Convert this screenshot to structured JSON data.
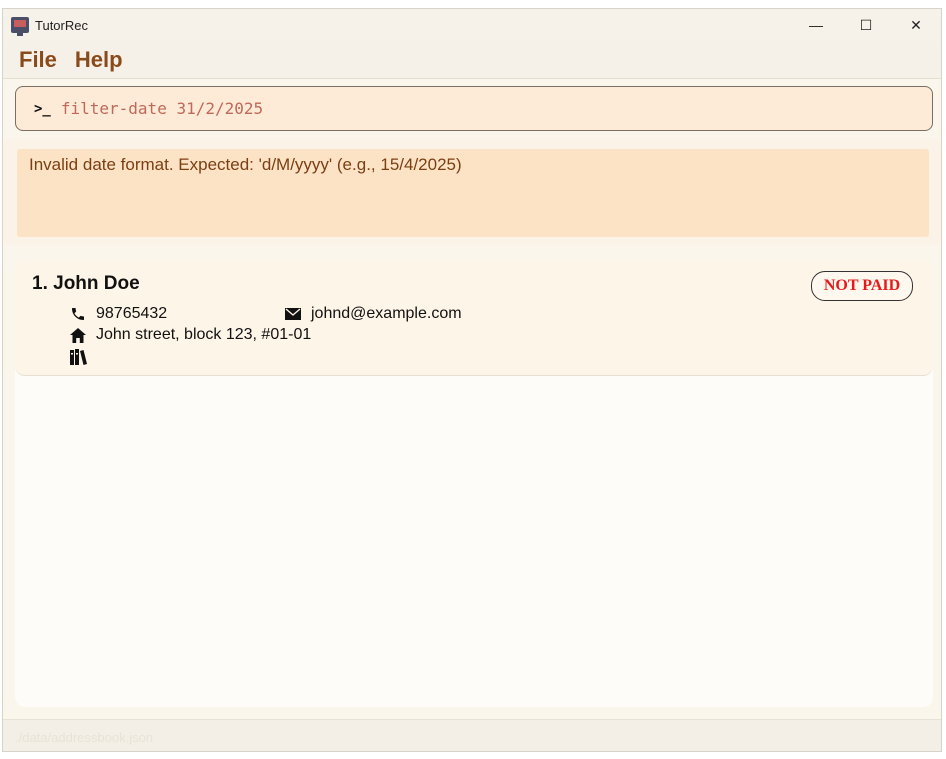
{
  "window": {
    "title": "TutorRec"
  },
  "controls": {
    "minimize": "—",
    "maximize": "☐",
    "close": "✕"
  },
  "menu": {
    "items": [
      "File",
      "Help"
    ]
  },
  "command": {
    "prompt": ">_",
    "value": "filter-date 31/2/2025"
  },
  "result": {
    "message": "Invalid date format. Expected: 'd/M/yyyy' (e.g., 15/4/2025)"
  },
  "persons": [
    {
      "index_name": "1. John Doe",
      "phone": "98765432",
      "email": "johnd@example.com",
      "address": "John street, block 123, #01-01",
      "payment_status": "NOT PAID",
      "icons": {
        "phone": "phone-icon",
        "email": "email-icon",
        "address": "home-icon",
        "subjects": "books-icon"
      }
    }
  ],
  "status": {
    "path": "./data/addressbook.json"
  },
  "colors": {
    "accent": "#8a4b1c",
    "not_paid": "#e61a1a",
    "result_bg": "#fde3c6",
    "command_bg": "#fdebd7"
  }
}
